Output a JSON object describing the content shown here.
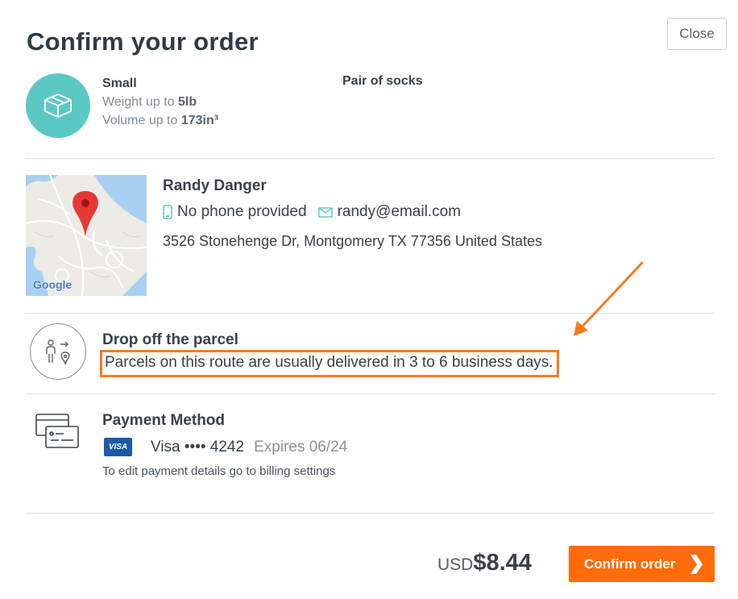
{
  "header": {
    "title": "Confirm your order",
    "close_label": "Close"
  },
  "package": {
    "icon": "box-icon",
    "name": "Small",
    "weight_prefix": "Weight up to ",
    "weight_value": "5lb",
    "volume_prefix": "Volume up to ",
    "volume_value": "173in³",
    "item": "Pair of socks",
    "accent_color": "#5bc8c4"
  },
  "recipient": {
    "map_label": "Google",
    "name": "Randy Danger",
    "phone": "No phone provided",
    "email": "randy@email.com",
    "address": "3526 Stonehenge Dr, Montgomery TX 77356 United States"
  },
  "delivery": {
    "title": "Drop off the parcel",
    "description": "Parcels on this route are usually delivered in 3 to 6 business days.",
    "highlight_color": "#f57c1f"
  },
  "payment": {
    "title": "Payment Method",
    "card_brand": "VISA",
    "card_text": "Visa •••• 4242",
    "expires": "Expires 06/24",
    "note": "To edit payment details go to billing settings"
  },
  "footer": {
    "currency": "USD",
    "amount": "$8.44",
    "confirm_label": "Confirm order",
    "button_color": "#ff6c0a"
  }
}
